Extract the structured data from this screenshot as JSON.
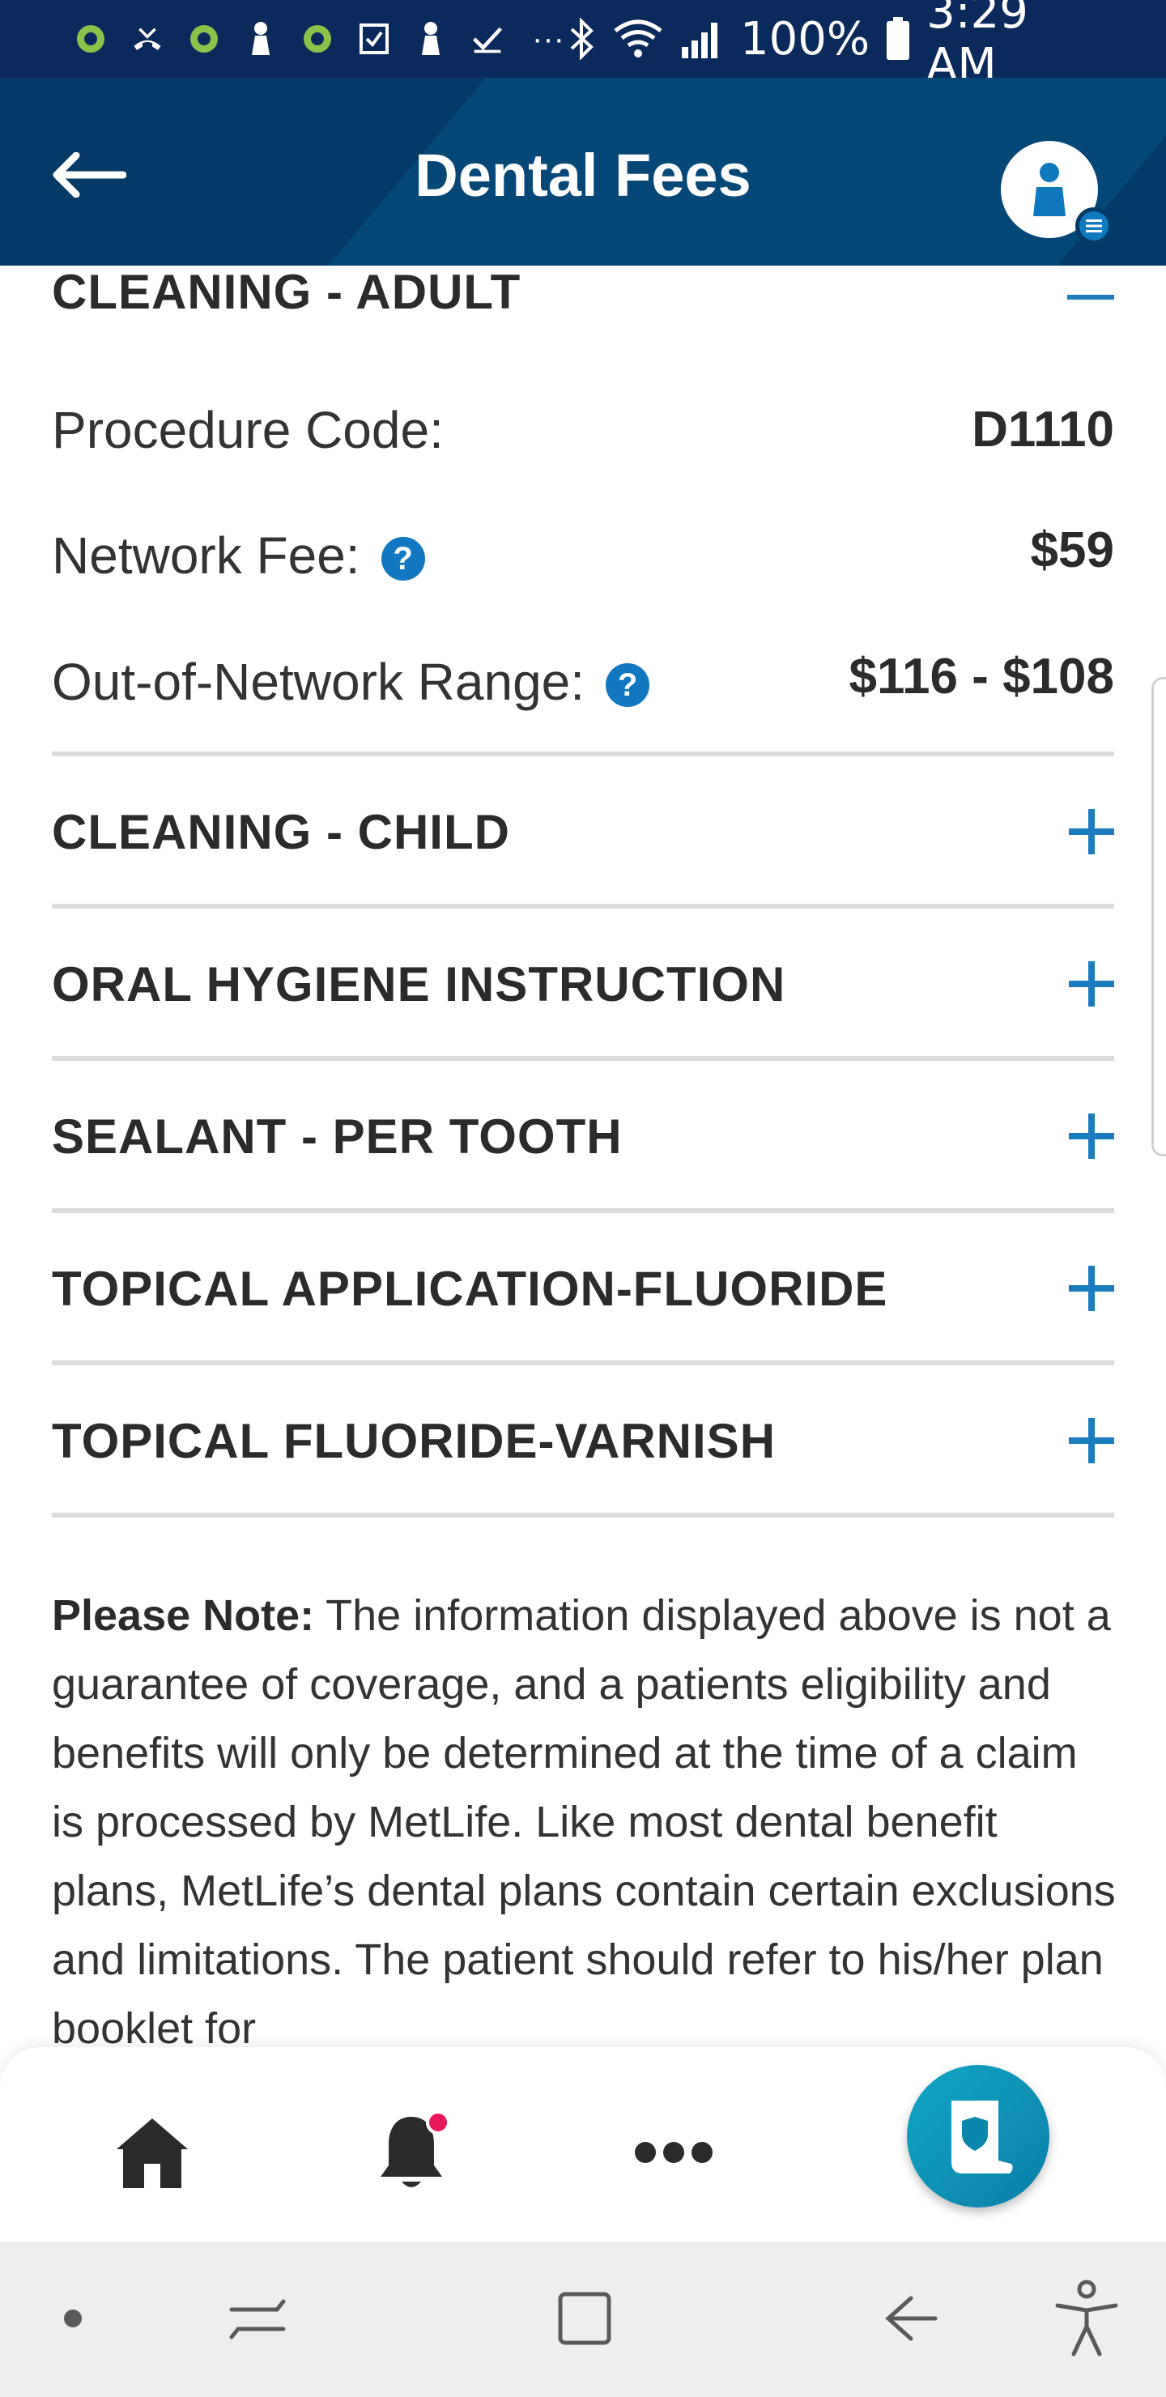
{
  "status_bar": {
    "battery": "100%",
    "time": "3:29 AM",
    "more": "···"
  },
  "header": {
    "title": "Dental Fees"
  },
  "expanded_item": {
    "title": "CLEANING - ADULT",
    "details": [
      {
        "label": "Procedure Code:",
        "value": "D1110",
        "help": false
      },
      {
        "label": "Network Fee:",
        "value": "$59",
        "help": true
      },
      {
        "label": "Out-of-Network Range:",
        "value": "$116 - $108",
        "help": true
      }
    ],
    "help_glyph": "?"
  },
  "fee_items": [
    {
      "label": "CLEANING - CHILD"
    },
    {
      "label": "ORAL HYGIENE INSTRUCTION"
    },
    {
      "label": "SEALANT - PER TOOTH"
    },
    {
      "label": "TOPICAL APPLICATION-FLUORIDE"
    },
    {
      "label": "TOPICAL FLUORIDE-VARNISH"
    }
  ],
  "disclaimer": {
    "lead": "Please Note:",
    "text": " The information displayed above is not a guarantee of coverage, and a patients eligibility and benefits will only be determined at the time of a claim is processed by MetLife. Like most dental benefit plans, MetLife’s dental plans contain certain exclusions and limitations. The patient should refer to his/her plan booklet for"
  },
  "bottom_nav": {
    "items": [
      "home-icon",
      "bell-icon",
      "more-icon",
      "id-card-icon"
    ]
  },
  "colors": {
    "header": "#043a66",
    "status_bar": "#0b2a5c",
    "accent": "#1b7bbf",
    "fab": "#0f97b8",
    "notification": "#e8185a"
  }
}
